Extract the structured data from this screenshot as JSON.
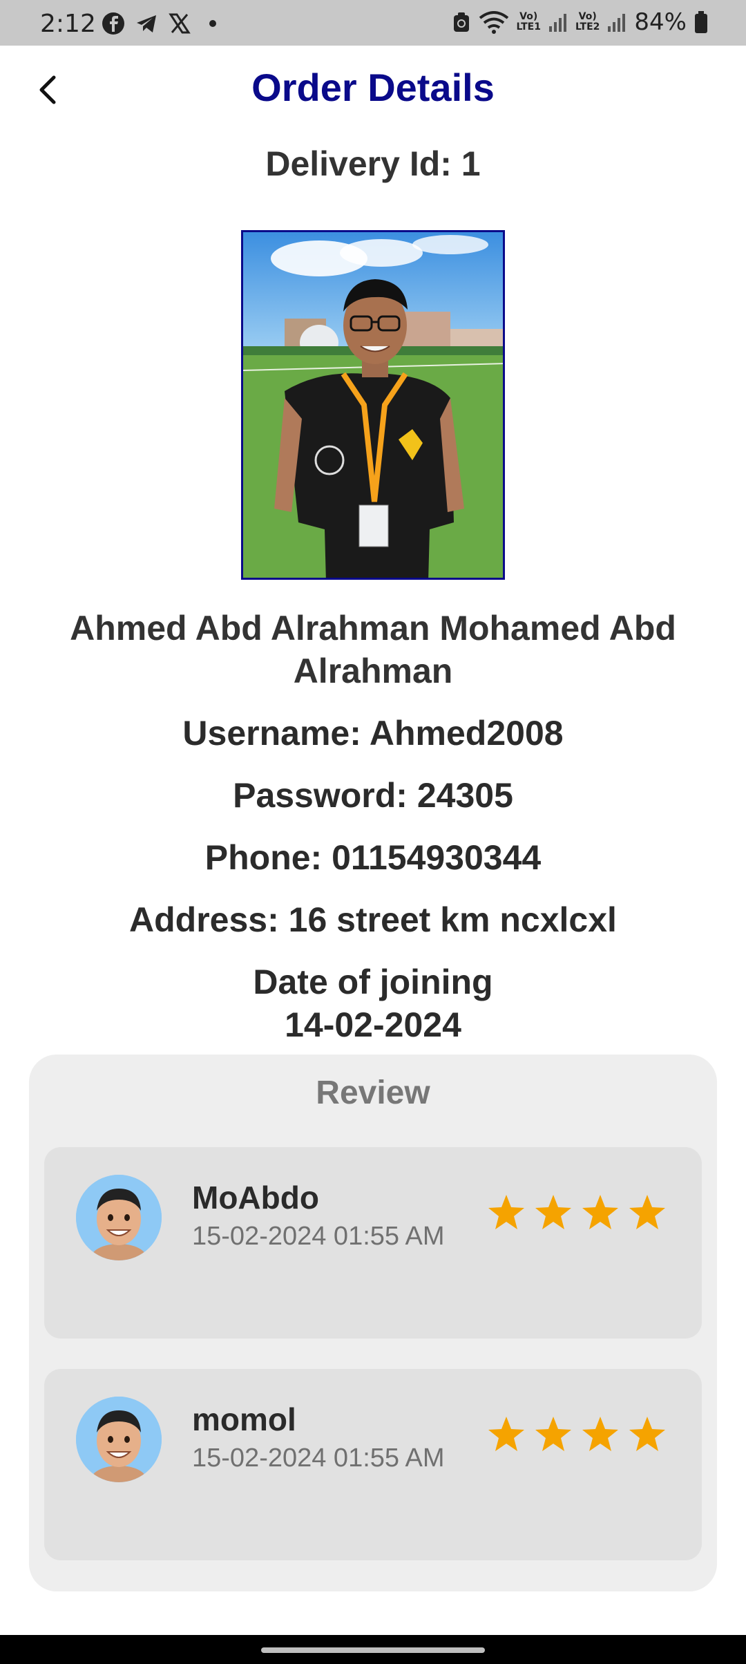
{
  "status_bar": {
    "time": "2:12",
    "icons_left": [
      "facebook-icon",
      "telegram-icon",
      "x-icon",
      "dot-icon"
    ],
    "lte1": "Vo)\nLTE1",
    "lte2": "Vo)\nLTE2",
    "battery": "84%"
  },
  "header": {
    "title": "Order Details"
  },
  "delivery": {
    "id_text": "Delivery Id: 1",
    "name": "Ahmed Abd Alrahman Mohamed Abd Alrahman",
    "username": "Username: Ahmed2008",
    "password": "Password: 24305",
    "phone": "Phone: 01154930344",
    "address": "Address: 16 street km ncxlcxl",
    "date_label": "Date of joining",
    "date_value": "14-02-2024"
  },
  "reviews": {
    "title": "Review",
    "items": [
      {
        "name": "MoAbdo",
        "date": "15-02-2024 01:55 AM",
        "rating": 4
      },
      {
        "name": "momol",
        "date": "15-02-2024 01:55 AM",
        "rating": 4
      }
    ]
  },
  "colors": {
    "title": "#0a0a8a",
    "star": "#f5a300",
    "card": "#eeeeee",
    "item": "#e1e1e1"
  }
}
